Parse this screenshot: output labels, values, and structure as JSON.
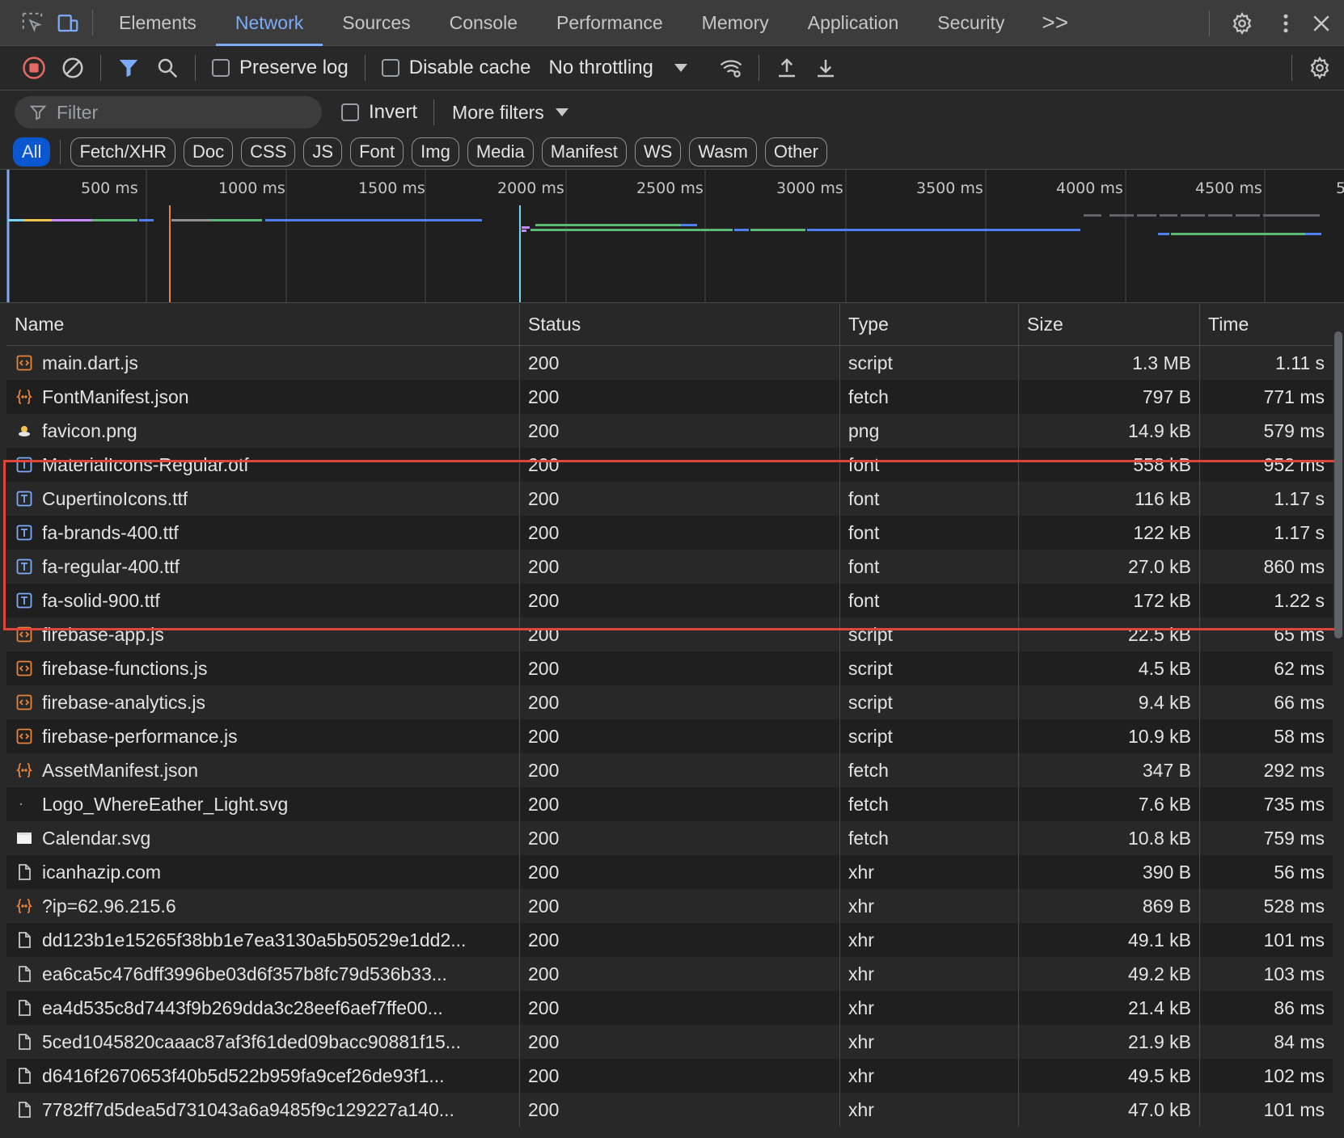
{
  "tabs": [
    {
      "label": "Elements"
    },
    {
      "label": "Network",
      "active": true
    },
    {
      "label": "Sources"
    },
    {
      "label": "Console"
    },
    {
      "label": "Performance"
    },
    {
      "label": "Memory"
    },
    {
      "label": "Application"
    },
    {
      "label": "Security"
    }
  ],
  "tabbar": {
    "more_label": ">>",
    "icons": [
      "inspect-element-icon",
      "device-toolbar-icon",
      "settings-icon",
      "more-vertical-icon",
      "close-icon"
    ]
  },
  "toolbar": {
    "preserve_log_label": "Preserve log",
    "preserve_log_checked": false,
    "disable_cache_label": "Disable cache",
    "disable_cache_checked": false,
    "throttling_value": "No throttling",
    "icons": [
      "stop-recording-icon",
      "clear-icon",
      "filter-icon",
      "search-icon",
      "network-conditions-icon",
      "import-har-icon",
      "export-har-icon",
      "network-settings-icon"
    ]
  },
  "filter": {
    "placeholder": "Filter",
    "invert_label": "Invert",
    "invert_checked": false,
    "more_filters_label": "More filters"
  },
  "type_chips": [
    {
      "label": "All",
      "active": true
    },
    {
      "label": "Fetch/XHR"
    },
    {
      "label": "Doc"
    },
    {
      "label": "CSS"
    },
    {
      "label": "JS"
    },
    {
      "label": "Font"
    },
    {
      "label": "Img"
    },
    {
      "label": "Media"
    },
    {
      "label": "Manifest"
    },
    {
      "label": "WS"
    },
    {
      "label": "Wasm"
    },
    {
      "label": "Other"
    }
  ],
  "overview": {
    "tick_labels": [
      "500 ms",
      "1000 ms",
      "1500 ms",
      "2000 ms",
      "2500 ms",
      "3000 ms",
      "3500 ms",
      "4000 ms",
      "4500 ms",
      "5"
    ]
  },
  "table": {
    "columns": [
      "Name",
      "Status",
      "Type",
      "Size",
      "Time"
    ],
    "rows": [
      {
        "name": "main.dart.js",
        "status": "200",
        "type": "script",
        "size": "1.3 MB",
        "time": "1.11 s",
        "icon": "script-icon"
      },
      {
        "name": "FontManifest.json",
        "status": "200",
        "type": "fetch",
        "size": "797 B",
        "time": "771 ms",
        "icon": "json-icon"
      },
      {
        "name": "favicon.png",
        "status": "200",
        "type": "png",
        "size": "14.9 kB",
        "time": "579 ms",
        "icon": "image-icon"
      },
      {
        "name": "MaterialIcons-Regular.otf",
        "status": "200",
        "type": "font",
        "size": "558 kB",
        "time": "952 ms",
        "icon": "font-icon"
      },
      {
        "name": "CupertinoIcons.ttf",
        "status": "200",
        "type": "font",
        "size": "116 kB",
        "time": "1.17 s",
        "icon": "font-icon"
      },
      {
        "name": "fa-brands-400.ttf",
        "status": "200",
        "type": "font",
        "size": "122 kB",
        "time": "1.17 s",
        "icon": "font-icon"
      },
      {
        "name": "fa-regular-400.ttf",
        "status": "200",
        "type": "font",
        "size": "27.0 kB",
        "time": "860 ms",
        "icon": "font-icon"
      },
      {
        "name": "fa-solid-900.ttf",
        "status": "200",
        "type": "font",
        "size": "172 kB",
        "time": "1.22 s",
        "icon": "font-icon"
      },
      {
        "name": "firebase-app.js",
        "status": "200",
        "type": "script",
        "size": "22.5 kB",
        "time": "65 ms",
        "icon": "script-icon"
      },
      {
        "name": "firebase-functions.js",
        "status": "200",
        "type": "script",
        "size": "4.5 kB",
        "time": "62 ms",
        "icon": "script-icon"
      },
      {
        "name": "firebase-analytics.js",
        "status": "200",
        "type": "script",
        "size": "9.4 kB",
        "time": "66 ms",
        "icon": "script-icon"
      },
      {
        "name": "firebase-performance.js",
        "status": "200",
        "type": "script",
        "size": "10.9 kB",
        "time": "58 ms",
        "icon": "script-icon"
      },
      {
        "name": "AssetManifest.json",
        "status": "200",
        "type": "fetch",
        "size": "347 B",
        "time": "292 ms",
        "icon": "json-icon"
      },
      {
        "name": "Logo_WhereEather_Light.svg",
        "status": "200",
        "type": "fetch",
        "size": "7.6 kB",
        "time": "735 ms",
        "icon": "svg-dot-icon"
      },
      {
        "name": "Calendar.svg",
        "status": "200",
        "type": "fetch",
        "size": "10.8 kB",
        "time": "759 ms",
        "icon": "svg-image-icon"
      },
      {
        "name": "icanhazip.com",
        "status": "200",
        "type": "xhr",
        "size": "390 B",
        "time": "56 ms",
        "icon": "document-icon"
      },
      {
        "name": "?ip=62.96.215.6",
        "status": "200",
        "type": "xhr",
        "size": "869 B",
        "time": "528 ms",
        "icon": "json-icon"
      },
      {
        "name": "dd123b1e15265f38bb1e7ea3130a5b50529e1dd2...",
        "status": "200",
        "type": "xhr",
        "size": "49.1 kB",
        "time": "101 ms",
        "icon": "document-icon"
      },
      {
        "name": "ea6ca5c476dff3996be03d6f357b8fc79d536b33...",
        "status": "200",
        "type": "xhr",
        "size": "49.2 kB",
        "time": "103 ms",
        "icon": "document-icon"
      },
      {
        "name": "ea4d535c8d7443f9b269dda3c28eef6aef7ffe00...",
        "status": "200",
        "type": "xhr",
        "size": "21.4 kB",
        "time": "86 ms",
        "icon": "document-icon"
      },
      {
        "name": "5ced1045820caaac87af3f61ded09bacc90881f15...",
        "status": "200",
        "type": "xhr",
        "size": "21.9 kB",
        "time": "84 ms",
        "icon": "document-icon"
      },
      {
        "name": "d6416f2670653f40b5d522b959fa9cef26de93f1...",
        "status": "200",
        "type": "xhr",
        "size": "49.5 kB",
        "time": "102 ms",
        "icon": "document-icon"
      },
      {
        "name": "7782ff7d5dea5d731043a6a9485f9c129227a140...",
        "status": "200",
        "type": "xhr",
        "size": "47.0 kB",
        "time": "101 ms",
        "icon": "document-icon"
      }
    ]
  },
  "colors": {
    "accent": "#7cacf8",
    "active_chip": "#0b57d0",
    "record_red": "#e46962",
    "script_orange": "#e8833a",
    "font_blue": "#7cacf8",
    "highlight": "#e0443a",
    "timeline_green": "#5bb974",
    "timeline_blue": "#4f7ff0"
  }
}
